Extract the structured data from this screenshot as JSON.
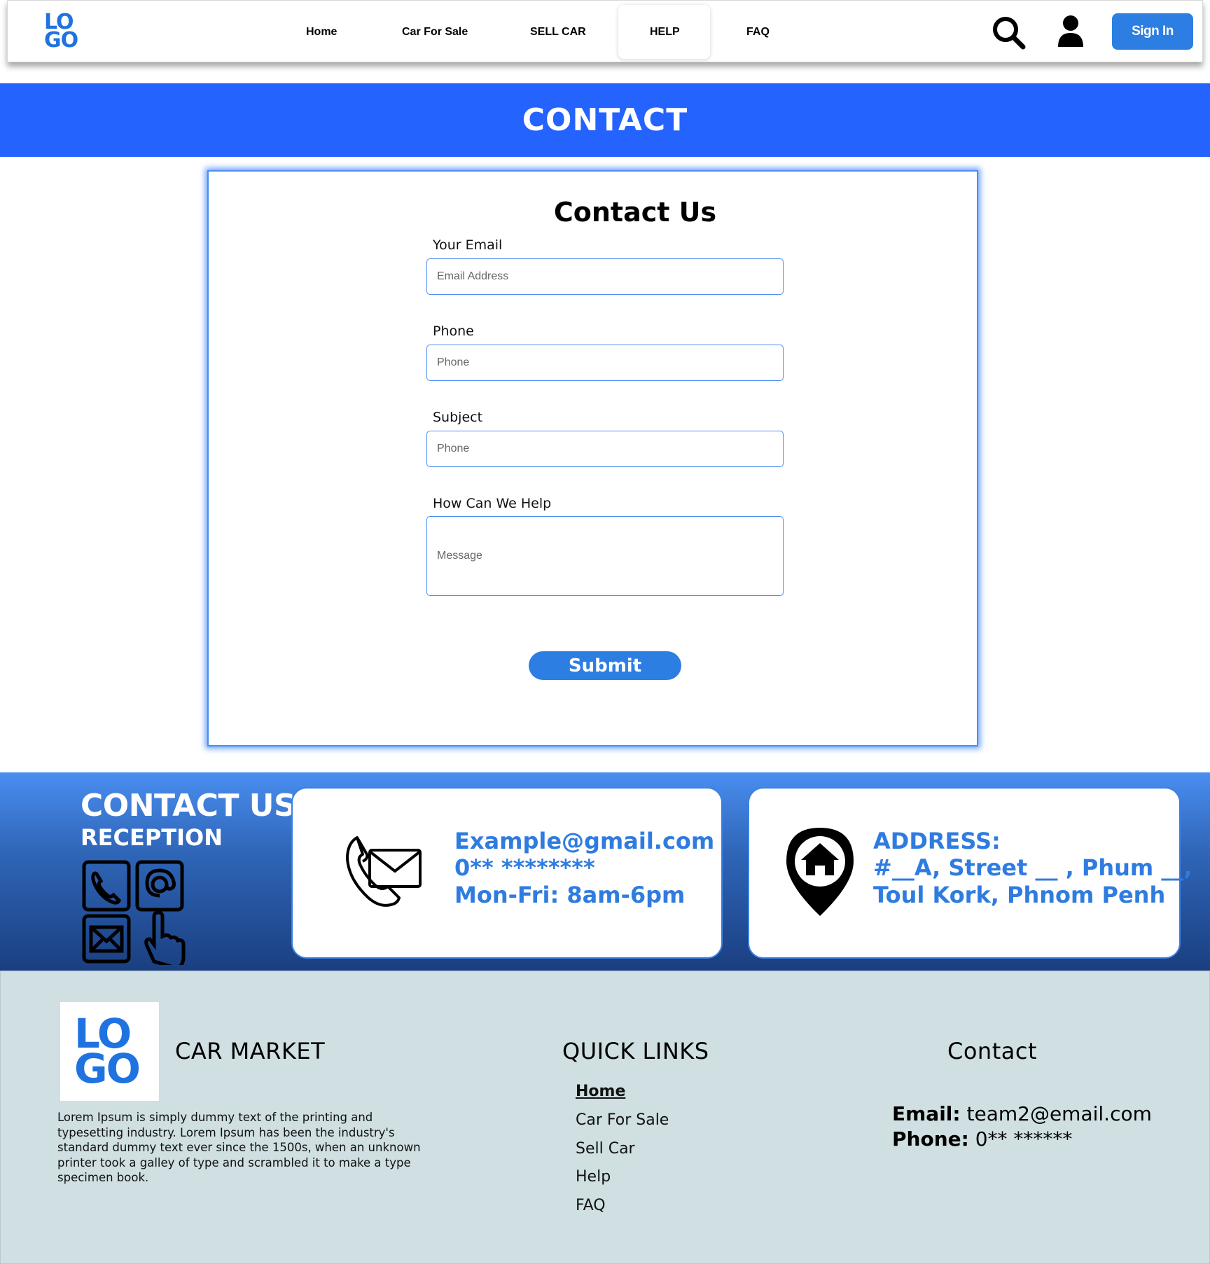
{
  "header": {
    "logo_top": "LO",
    "logo_bottom": "GO",
    "nav": [
      "Home",
      "Car For Sale",
      "SELL CAR",
      "HELP",
      "FAQ"
    ],
    "signin_label": "Sign In"
  },
  "banner": {
    "title": "CONTACT"
  },
  "form": {
    "title": "Contact Us",
    "email_label": "Your Email",
    "email_placeholder": "Email Address",
    "phone_label": "Phone",
    "phone_placeholder": "Phone",
    "subject_label": "Subject",
    "subject_placeholder": "Phone",
    "help_label": "How Can We Help",
    "message_placeholder": "Message",
    "submit_label": "Submit"
  },
  "contact_strip": {
    "title": "CONTACT US",
    "subtitle": "RECEPTION",
    "email": "Example@gmail.com",
    "phone": "0** ********",
    "hours": "Mon-Fri: 8am-6pm",
    "address_label": "ADDRESS:",
    "address_line1": "#__A, Street __ , Phum __,",
    "address_line2": "Toul Kork, Phnom Penh"
  },
  "footer": {
    "logo_top": "LO",
    "logo_bottom": "GO",
    "brand": "CAR MARKET",
    "description": "Lorem Ipsum is simply dummy text of the printing and typesetting industry. Lorem Ipsum has been the industry's standard dummy text ever since the 1500s, when an unknown printer took a galley of type and scrambled it to make a type specimen book.",
    "quick_links_title": "QUICK LINKS",
    "quick_links": [
      "Home",
      "Car For Sale",
      "Sell Car",
      "Help",
      "FAQ"
    ],
    "contact_title": "Contact",
    "email_label": "Email:",
    "email_value": "team2@email.com",
    "phone_label": "Phone:",
    "phone_value": "0** ******"
  },
  "colors": {
    "accent": "#2d7ee2",
    "banner": "#2563ff",
    "footer_bg": "#cfdfe2",
    "info_text": "#2f7ce0"
  },
  "icons": [
    "search-icon",
    "user-icon",
    "phone-mail-icon",
    "location-home-icon",
    "contact-grid-icon"
  ]
}
